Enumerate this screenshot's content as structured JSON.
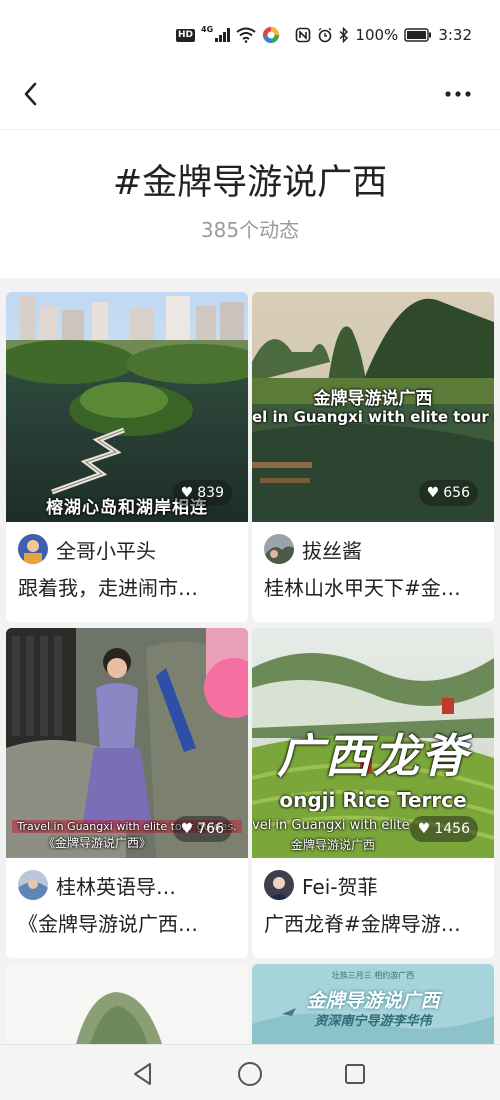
{
  "status_bar": {
    "network": "4G",
    "hd": "HD",
    "battery": "100%",
    "time": "3:32"
  },
  "header": {
    "back_icon": "chevron-left-icon",
    "more_icon": "more-horizontal-icon"
  },
  "topic": {
    "title": "#金牌导游说广西",
    "count": "385个动态"
  },
  "cards": [
    {
      "likes": "839",
      "overlay": "榕湖心岛和湖岸相连",
      "author": "全哥小平头",
      "description": "跟着我，走进闹市…"
    },
    {
      "likes": "656",
      "overlay_title": "金牌导游说广西",
      "overlay_sub": "el in Guangxi with elite tour gu",
      "author": "拔丝酱",
      "description": "桂林山水甲天下#金…"
    },
    {
      "likes": "766",
      "overlay_sub": "Travel in Guangxi  with elite tour guides.",
      "overlay_title": "《金牌导游说广西》",
      "author": "桂林英语导…",
      "description": "《金牌导游说广西…"
    },
    {
      "likes": "1456",
      "overlay_big": "广西龙脊",
      "overlay_en": "ongji Rice Terrce",
      "overlay_sub": "vel in Guangxi with elite",
      "overlay_title": "金牌导游说广西",
      "author": "Fei-贺菲",
      "description": "广西龙脊#金牌导游…"
    },
    {
      "partial": true
    },
    {
      "partial": true,
      "overlay_top": "壮族三月三  相约游广西",
      "overlay_title": "金牌导游说广西",
      "overlay_sub": "资深南宁导游李华伟"
    }
  ],
  "nav": {
    "back_icon": "triangle-back-icon",
    "home_icon": "circle-home-icon",
    "recents_icon": "square-recents-icon"
  }
}
